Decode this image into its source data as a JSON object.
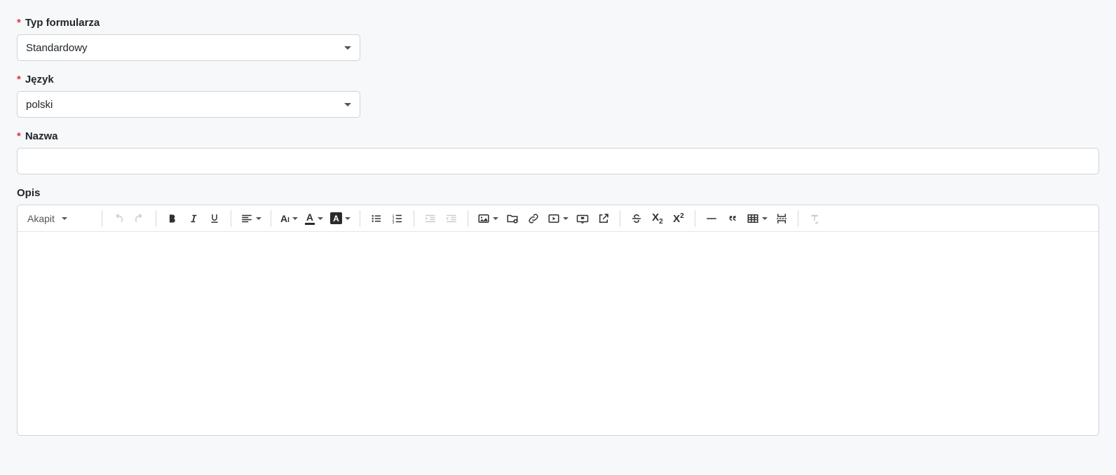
{
  "form": {
    "type_label": "Typ formularza",
    "type_value": "Standardowy",
    "language_label": "Język",
    "language_value": "polski",
    "name_label": "Nazwa",
    "name_value": "",
    "description_label": "Opis"
  },
  "editor": {
    "block_format": "Akapit"
  }
}
